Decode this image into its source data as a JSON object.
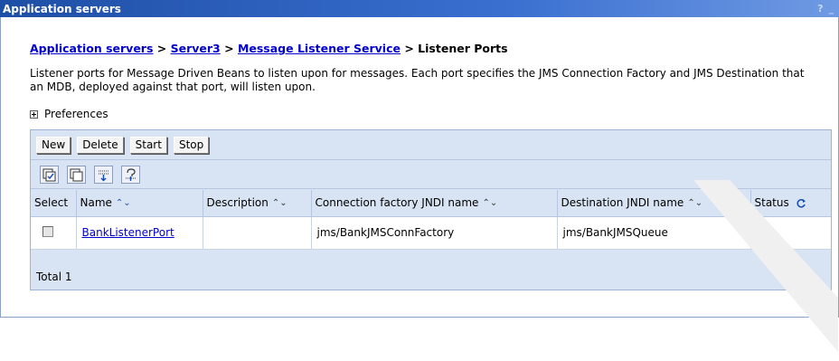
{
  "window": {
    "title": "Application servers",
    "help": "?",
    "minimize": "_"
  },
  "breadcrumb": {
    "items": [
      "Application servers",
      "Server3",
      "Message Listener Service"
    ],
    "separator": ">",
    "current": "Listener Ports"
  },
  "description": "Listener ports for Message Driven Beans to listen upon for messages. Each port specifies the JMS Connection Factory and JMS Destination that an MDB, deployed against that port, will listen upon.",
  "preferences": {
    "label": "Preferences",
    "icon": "expand-plus-icon"
  },
  "buttons": [
    "New",
    "Delete",
    "Start",
    "Stop"
  ],
  "icon_buttons": [
    "select-all-icon",
    "deselect-all-icon",
    "show-filter-icon",
    "clear-filter-icon"
  ],
  "table": {
    "columns": [
      "Select",
      "Name",
      "Description",
      "Connection factory JNDI name",
      "Destination JNDI name",
      "Status"
    ],
    "rows": [
      {
        "name": "BankListenerPort",
        "description": "",
        "connection_factory": "jms/BankJMSConnFactory",
        "destination": "jms/BankJMSQueue",
        "status_icon": "stopped-red-x-icon"
      }
    ],
    "total": "Total 1"
  },
  "colors": {
    "titlebar": "#1e4fa6",
    "panel": "#d8e4f3",
    "link": "#0000cc",
    "status_stopped": "#c4121b"
  }
}
